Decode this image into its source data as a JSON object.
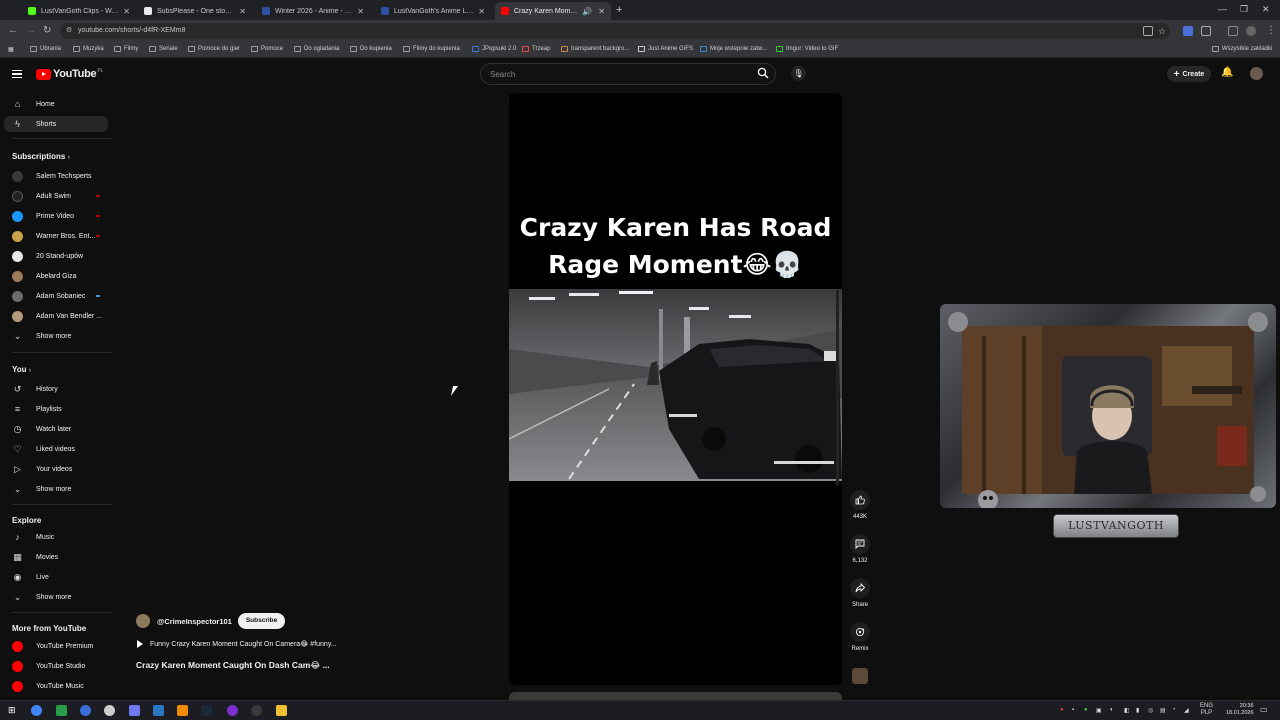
{
  "browser": {
    "tabs": [
      {
        "title": "LustVanGoth Clips - Watch Liv",
        "fav": "#53fc18"
      },
      {
        "title": "SubsPlease - One stop shop fo",
        "fav": "#e8eaed"
      },
      {
        "title": "Winter 2026 - Anime - MyAnim",
        "fav": "#2e51a2"
      },
      {
        "title": "LustVanGoth's Anime List - My",
        "fav": "#2e51a2"
      },
      {
        "title": "Crazy Karen Moment Caug",
        "fav": "#ff0000"
      }
    ],
    "new_tab": "+",
    "url": "youtube.com/shorts/-d4fR-XEMm8",
    "bookmarks": [
      "Ubrania",
      "Muzyka",
      "Filmy",
      "Seriale",
      "Pomoce do gier",
      "Pomoce",
      "Do ogladania",
      "Do kupienia",
      "Filmy do kupienia",
      "JPopsuki 2.0",
      "Trzeap",
      "transparent backgro...",
      "Just Anime GIFS",
      "Moje wstepnie zatw...",
      "Imgur: Video to GIF"
    ],
    "all_bookmarks": "Wszystkie zakladki"
  },
  "header": {
    "logo_text": "YouTube",
    "logo_country": "PL",
    "search_placeholder": "Search",
    "create_label": "Create"
  },
  "sidebar": {
    "top_items": [
      {
        "label": "Home",
        "icon": "home-icon",
        "glyph": "⌂"
      },
      {
        "label": "Shorts",
        "icon": "shorts-icon",
        "glyph": "⚡"
      }
    ],
    "subscriptions_heading": "Subscriptions",
    "subscriptions": [
      {
        "label": "Salem Techsperts",
        "color": "#3a3a3a",
        "live": false
      },
      {
        "label": "Adult Swim",
        "color": "#111111",
        "live": true
      },
      {
        "label": "Prime Video",
        "color": "#1a98ff",
        "live": true
      },
      {
        "label": "Warner Bros. Ent...",
        "color": "#c9a24a",
        "live": true
      },
      {
        "label": "20 Stand-upów",
        "color": "#e8e8e8",
        "live": false
      },
      {
        "label": "Abelard Giza",
        "color": "#9b7b5a",
        "live": false
      },
      {
        "label": "Adam Sobaniec",
        "color": "#6b6b6b",
        "live": true
      },
      {
        "label": "Adam Van Bendler ...",
        "color": "#b39b7b",
        "live": false
      }
    ],
    "show_more": "Show more",
    "you_heading": "You",
    "you_items": [
      {
        "label": "History",
        "icon": "history-icon",
        "glyph": "↺"
      },
      {
        "label": "Playlists",
        "icon": "playlists-icon",
        "glyph": "≡"
      },
      {
        "label": "Watch later",
        "icon": "watch-later-icon",
        "glyph": "◷"
      },
      {
        "label": "Liked videos",
        "icon": "like-icon",
        "glyph": "👍"
      },
      {
        "label": "Your videos",
        "icon": "your-videos-icon",
        "glyph": "▶"
      }
    ],
    "explore_heading": "Explore",
    "explore_items": [
      {
        "label": "Music",
        "icon": "music-icon",
        "glyph": "♪"
      },
      {
        "label": "Movies",
        "icon": "movies-icon",
        "glyph": "▦"
      },
      {
        "label": "Live",
        "icon": "live-icon",
        "glyph": "◉"
      }
    ],
    "more_heading": "More from YouTube",
    "more_items": [
      {
        "label": "YouTube Premium",
        "color": "#ff0000"
      },
      {
        "label": "YouTube Studio",
        "color": "#ff0000"
      },
      {
        "label": "YouTube Music",
        "color": "#ff0000"
      }
    ]
  },
  "short": {
    "title": "Crazy Karen Has Road Rage Moment😂💀",
    "channel": "@CrimeInspector101",
    "subscribe_label": "Subscribe",
    "sound": "Funny Crazy Karen Moment Caught On Camera😂 #funny...",
    "caption": "Crazy Karen Moment Caught On Dash Cam😂 ...",
    "actions": [
      {
        "name": "like",
        "glyph": "👍",
        "count": "443K"
      },
      {
        "name": "comments",
        "glyph": "💬",
        "count": "6,132"
      },
      {
        "name": "share",
        "glyph": "↪",
        "count": "Share"
      },
      {
        "name": "remix",
        "glyph": "⟳",
        "count": "Remix"
      }
    ]
  },
  "webcam": {
    "label": "LUSTVANGOTH"
  },
  "taskbar": {
    "lang": "ENG",
    "lang2": "PLP",
    "time": "20:36",
    "date": "18.01.2026"
  }
}
